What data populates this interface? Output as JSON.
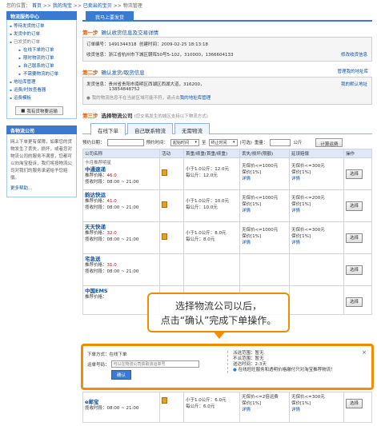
{
  "breadcrumb": {
    "prefix": "您的位置：",
    "items": [
      "首页",
      ">>",
      "我的淘宝",
      ">>",
      "已卖出的宝贝",
      ">>",
      "物流管理"
    ]
  },
  "sidebar": {
    "header": "物流服务中心",
    "items": [
      {
        "label": "等待发货的订单",
        "sub": false,
        "gray": false
      },
      {
        "label": "发货中的订单",
        "sub": false,
        "gray": false
      },
      {
        "label": "已发货的订单",
        "sub": false,
        "gray": true
      },
      {
        "label": "在线下单的订单",
        "sub": true,
        "gray": false
      },
      {
        "label": "限时物流的订单",
        "sub": true,
        "gray": false
      },
      {
        "label": "自己联系的订单",
        "sub": true,
        "gray": false
      },
      {
        "label": "不需要物流的订单",
        "sub": true,
        "gray": false
      },
      {
        "label": "地址库管理",
        "sub": false,
        "gray": false
      },
      {
        "label": "运费/时效查看器",
        "sub": false,
        "gray": false
      },
      {
        "label": "运费模板",
        "sub": false,
        "gray": false
      }
    ],
    "button": "我有货物要运输",
    "header2": "各物流公司",
    "text": "网上下单更有保障，如果您的货物发生了丢失，损坏，或者您对物流公司的服务不满意，您都可以向淘宝投诉，我们将按物流公司对我们的服务承诺给予您赔偿。",
    "more": "更多帮助..."
  },
  "main": {
    "tab": "我马上要发货",
    "step1": {
      "num": "第一步",
      "title": "确认收货信息及交易详情",
      "order_label": "订单编号：",
      "order": "1491344318",
      "created_label": "创建时间：",
      "created": "2009-02-25 18:13:18",
      "addr_label": "收货信息：",
      "addr": "浙江省杭州市下城区朝晖50号5-102，310000，",
      "phone": "1366604133",
      "edit": "修改收货信息"
    },
    "step2": {
      "num": "第二步",
      "title": "确认发货/取货信息",
      "manage": "管理我的地址库",
      "send_label": "发货信息：",
      "send": "贵州省贵阳市南明区西湖区西湖大道，316200，",
      "phone": "13854848752",
      "note": "我的物流信息不在当前区域可能不符，请点击",
      "note_link": "我的地址库管理",
      "default": "我的默认地址"
    },
    "step3": {
      "num": "第三步",
      "title": "选择物流公司",
      "desc": "(您交易发生的城区支持以下物流方式)"
    },
    "tabs": [
      "在线下单",
      "自己联系物流",
      "无需物流"
    ],
    "filter": {
      "date_label": "预约日期：",
      "time_label": "预约时间：",
      "time_from": "起始时间",
      "to": "至",
      "time_to": "终止时间",
      "opt": "(可选)",
      "weight_label": "重量：",
      "unit": "公斤",
      "calc": "计算运费"
    },
    "table_head": [
      "公司名称",
      "活动",
      "首重/续重(首重/续重)",
      "丢失/损坏(限额)",
      "延误赔偿",
      "操作"
    ],
    "rows": [
      {
        "name": "中通速递",
        "badge": "卡月推荐明星",
        "price_label": "推荐价格：",
        "price": "46.0",
        "time_label": "揽收时段：",
        "time": "08:00 ~ 21:00",
        "rate1": "小于1.0公斤：12.0元",
        "rate2": "每公斤：12.0元",
        "loss1": "无保价<=1000元",
        "loss2": "保价[1%]",
        "loss3": "详情",
        "late1": "无保价<=300元",
        "late2": "保价[1%]",
        "late3": "详情",
        "btn": "选择"
      },
      {
        "name": "韵达快运",
        "badge": "",
        "price_label": "推荐价格：",
        "price": "41.0",
        "time_label": "揽收时段：",
        "time": "08:00 ~ 21:00",
        "rate1": "小于1.0公斤：10.0元",
        "rate2": "每公斤：10.0元",
        "loss1": "无保价<=1000元",
        "loss2": "保价[1%]",
        "loss3": "详情",
        "late1": "无保价<=200元",
        "late2": "保价[1%]",
        "late3": "详情",
        "btn": "选择"
      },
      {
        "name": "天天快递",
        "badge": "",
        "price_label": "推荐价格：",
        "price": "32.0",
        "time_label": "揽收时段：",
        "time": "08:00 ~ 21:00",
        "rate1": "小于1.0公斤：8.0元",
        "rate2": "每公斤：8.0元",
        "loss1": "无保价<=1000元",
        "loss2": "保价[1%]",
        "loss3": "详情",
        "late1": "无保价<=300元",
        "late2": "保价[1%]",
        "late3": "详情",
        "btn": "选择"
      },
      {
        "name": "宅急送",
        "badge": "",
        "price_label": "推荐价格：",
        "price": "31.0",
        "time_label": "揽收时段：",
        "time": "08:00 ~ 21:00",
        "rate1": "",
        "rate2": "",
        "loss1": "",
        "loss2": "",
        "loss3": "",
        "late1": "",
        "late2": "",
        "late3": "",
        "btn": "选择"
      },
      {
        "name": "中国EMS",
        "badge": "",
        "price_label": "推荐价格：",
        "price": "",
        "time_label": "揽收时段：",
        "time": "",
        "rate1": "",
        "rate2": "",
        "loss1": "",
        "loss2": "",
        "loss3": "",
        "late1": "",
        "late2": "",
        "late3": "",
        "btn": "选择"
      },
      {
        "name": "e邮宝",
        "badge": "",
        "price_label": "",
        "price": "",
        "time_label": "揽收时段：",
        "time": "08:00 ~ 21:00",
        "rate1": "小于1.0公斤：6.0元",
        "rate2": "每公斤：6.0元",
        "loss1": "无保价<=2倍运费",
        "loss2": "保价[1%]",
        "loss3": "详情",
        "late1": "无保价<=300元",
        "late2": "保价[1%]",
        "late3": "详情",
        "btn": "选择"
      }
    ]
  },
  "callout": {
    "line1": "选择物流公司以后，",
    "line2": "点击“确认”完成下单操作。"
  },
  "dialog": {
    "mode_label": "下单方式：",
    "mode": "在线下单",
    "waybill_label": "运单号码：",
    "placeholder": "可以在物流公司获取该运单号",
    "confirm": "确认",
    "scope_label": "派送范围：",
    "scope": "暂无",
    "noscope_label": "不派范围：",
    "noscope": "暂无",
    "eta_label": "送达时间：",
    "eta": "2-3天",
    "tip": "在线旺旺服务和透明价格缴付只对淘宝推荐物流！",
    "close": "×"
  }
}
